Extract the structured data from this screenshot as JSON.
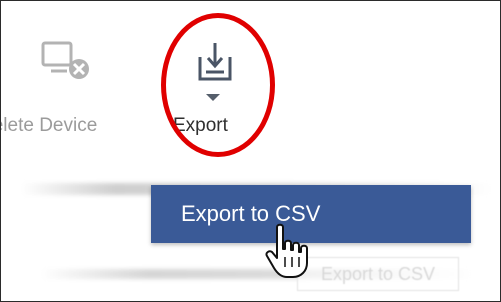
{
  "toolbar": {
    "delete_label": "Delete Device",
    "delete_icon": "monitor-remove-icon",
    "export_label": "Export",
    "export_icon": "download-tray-icon",
    "export_caret_icon": "caret-down-icon"
  },
  "dropdown": {
    "items": [
      {
        "label": "Export to CSV"
      }
    ],
    "ghost_label": "Export to CSV"
  },
  "annotation": {
    "highlight_color": "#e00000",
    "menu_color": "#3a5a97"
  },
  "cursor": {
    "icon": "hand-pointer-icon"
  }
}
